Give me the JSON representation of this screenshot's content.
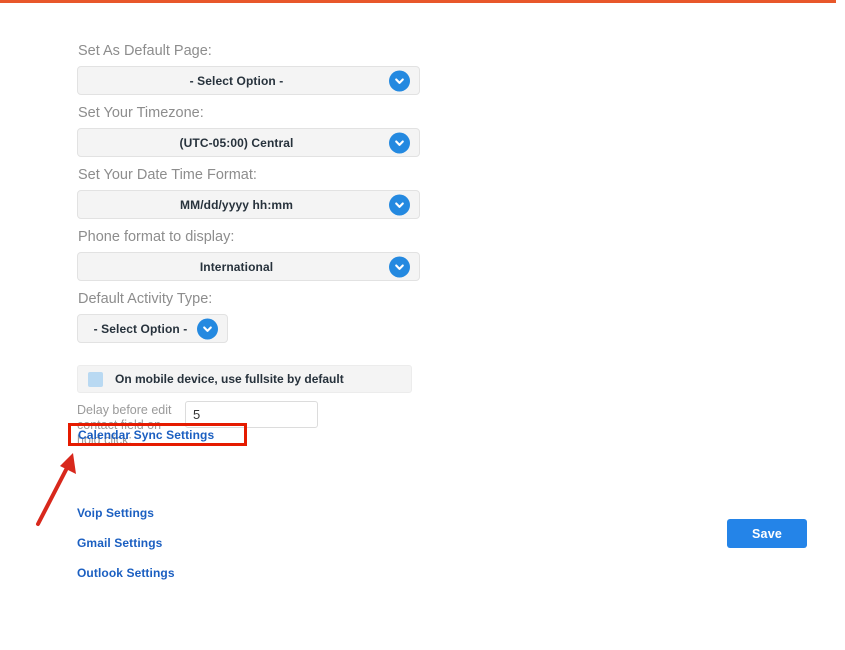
{
  "page": {
    "top_rule_color": "#e8572a",
    "accent_blue": "#2484e8",
    "link_blue": "#1b5fc1",
    "highlight_red": "#e51b00"
  },
  "form": {
    "fields": [
      {
        "label": "Set As Default Page:",
        "value": "- Select Option -",
        "icon": "chevron-down-icon",
        "width": "wide"
      },
      {
        "label": "Set Your Timezone:",
        "value": "(UTC-05:00) Central",
        "icon": "chevron-down-icon",
        "width": "wide"
      },
      {
        "label": "Set Your Date Time Format:",
        "value": "MM/dd/yyyy hh:mm",
        "icon": "chevron-down-icon",
        "width": "wide"
      },
      {
        "label": "Phone format to display:",
        "value": "International",
        "icon": "chevron-down-icon",
        "width": "wide"
      },
      {
        "label": "Default Activity Type:",
        "value": "- Select Option -",
        "icon": "chevron-down-icon",
        "width": "narrow"
      }
    ],
    "checkbox": {
      "label": "On mobile device, use fullsite by default",
      "checked": false
    },
    "delay": {
      "label": "Delay before edit contact field on hold click:",
      "value": "5",
      "placeholder": ""
    }
  },
  "links": {
    "calendar_sync": "Calendar Sync Settings",
    "voip": "Voip Settings",
    "gmail": "Gmail Settings",
    "outlook": "Outlook Settings"
  },
  "annotation": {
    "highlighted_target": "Calendar Sync Settings",
    "arrow": "red-arrow-icon"
  },
  "actions": {
    "save_label": "Save"
  }
}
